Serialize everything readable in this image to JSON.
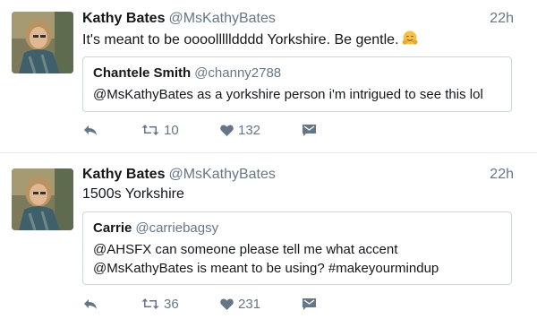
{
  "tweets": [
    {
      "author_name": "Kathy Bates",
      "author_handle": "@MsKathyBates",
      "time": "22h",
      "text": "It's meant to be oooollllldddd Yorkshire. Be gentle.",
      "emoji": "hugging-face",
      "quote": {
        "author_name": "Chantele Smith",
        "author_handle": "@channy2788",
        "text_lines": [
          "@MsKathyBates as a yorkshire person i'm intrigued to see this lol"
        ]
      },
      "retweets": "10",
      "likes": "132"
    },
    {
      "author_name": "Kathy Bates",
      "author_handle": "@MsKathyBates",
      "time": "22h",
      "text": "1500s Yorkshire",
      "quote": {
        "author_name": "Carrie",
        "author_handle": "@carriebagsy",
        "text_lines": [
          "@AHSFX can someone please tell me what accent",
          "@MsKathyBates is meant to be using? #makeyourmindup"
        ]
      },
      "retweets": "36",
      "likes": "231"
    }
  ],
  "colors": {
    "name": "#14171a",
    "secondary": "#657786",
    "border": "#ccd6dd",
    "divider": "#e6ecf0"
  },
  "icons": [
    "reply-icon",
    "retweet-icon",
    "heart-icon",
    "direct-message-icon",
    "hugging-face-emoji"
  ]
}
